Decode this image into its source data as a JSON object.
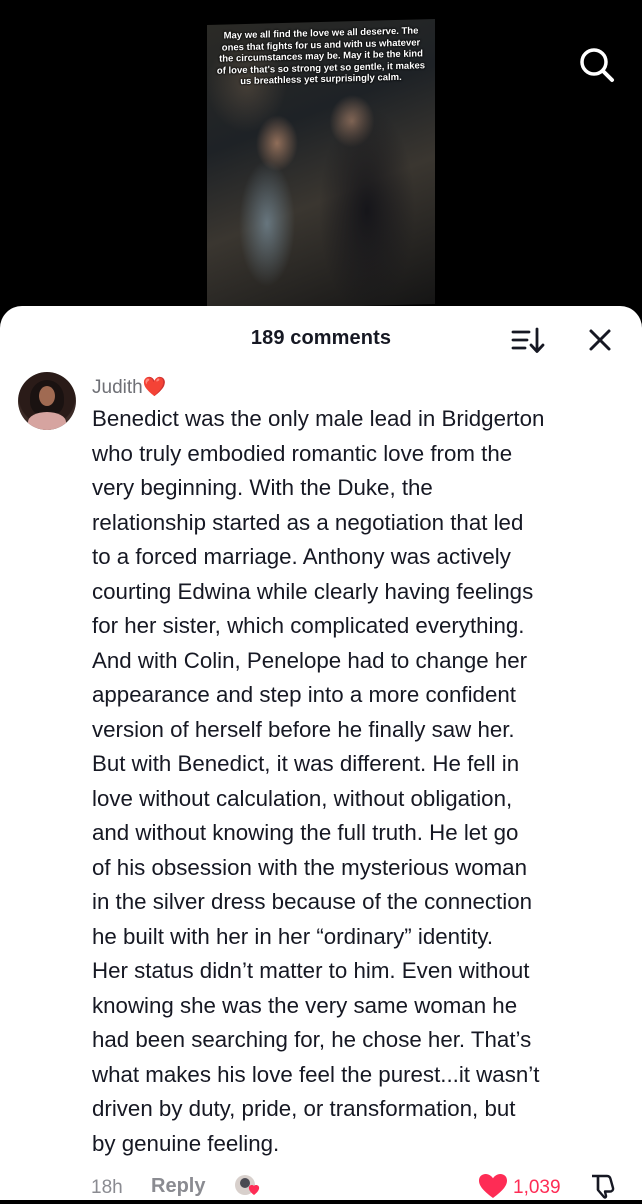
{
  "video": {
    "caption": "May we all find the love we all deserve. The ones that fights for us and with us whatever the circumstances may be. May it be the kind of love that's so strong yet so gentle, it makes us breathless yet surprisingly calm."
  },
  "icons": {
    "search": "search-icon",
    "sort": "sort-icon",
    "close": "close-icon",
    "like": "heart-icon",
    "dislike": "thumbs-down-icon",
    "creator_liked": "creator-liked-icon"
  },
  "comments_panel": {
    "count_label": "189 comments"
  },
  "comment": {
    "username": "Judith",
    "username_emoji": "❤️",
    "text": "Benedict was the only male lead in Bridgerton\nwho truly embodied romantic love from the\nvery beginning. With the Duke, the\nrelationship started as a negotiation that led\nto a forced marriage. Anthony was actively\ncourting Edwina while clearly having feelings\nfor her sister, which complicated everything.\nAnd with Colin, Penelope had to change her\nappearance and step into a more confident\nversion of herself before he finally saw her.\nBut with Benedict, it was different. He fell in\nlove without calculation, without obligation,\nand without knowing the full truth. He let go\nof his obsession with the mysterious woman\nin the silver dress because of the connection\nhe built with her in her “ordinary” identity.\nHer status didn’t matter to him. Even without\nknowing she was the very same woman he\nhad been searching for, he chose her. That’s\nwhat makes his love feel the purest...it wasn’t\ndriven by duty, pride, or transformation, but\nby genuine feeling.",
    "time": "18h",
    "reply_label": "Reply",
    "like_count": "1,039",
    "liked": true
  },
  "colors": {
    "accent": "#fe2c55",
    "text_primary": "#161823",
    "text_secondary": "#8a8b91"
  }
}
